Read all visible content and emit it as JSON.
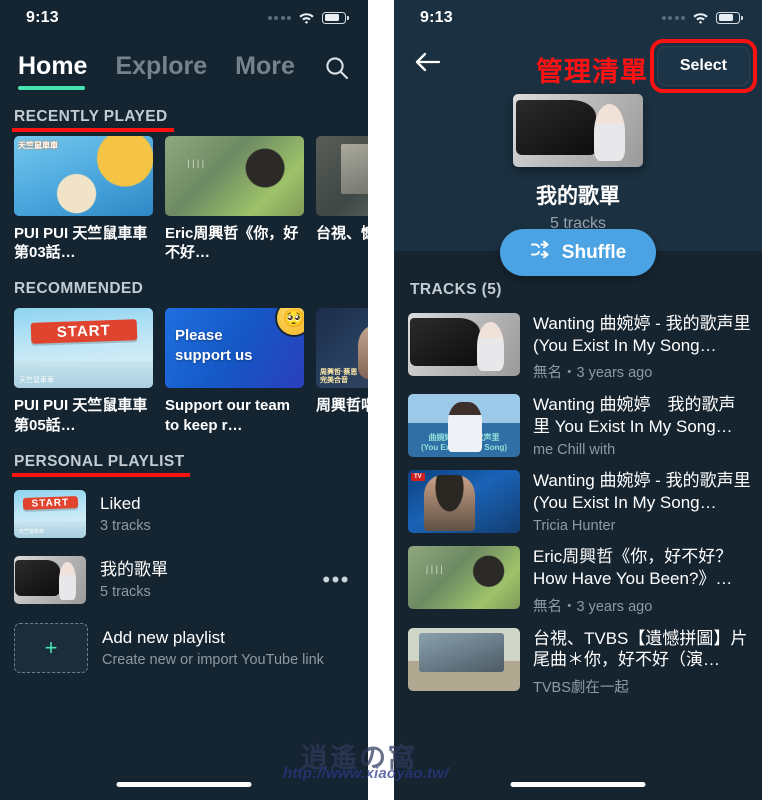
{
  "status_bar": {
    "time": "9:13",
    "wifi_icon": "wifi-icon",
    "battery_icon": "battery-icon",
    "signal_icon": "signal-dots-icon"
  },
  "colors": {
    "accent_green": "#49e3b0",
    "accent_blue": "#4ba3e3",
    "annotation_red": "#fc1212",
    "panel_bg": "#142430",
    "header_bg": "#1b3040"
  },
  "left_screen": {
    "tabs": [
      {
        "label": "Home",
        "active": true
      },
      {
        "label": "Explore",
        "active": false
      },
      {
        "label": "More",
        "active": false
      }
    ],
    "search_icon": "search-icon",
    "sections": {
      "recently_played": {
        "title": "RECENTLY PLAYED",
        "items": [
          {
            "title": "PUI PUI 天竺鼠車車 第03話…",
            "art": "art-pui",
            "badge": "天竺鼠車車"
          },
          {
            "title": "Eric周興哲《你，好不好…",
            "art": "art-eric",
            "badge": ""
          },
          {
            "title": "台視、憾拼圖",
            "art": "art-tvbs",
            "badge": ""
          }
        ]
      },
      "recommended": {
        "title": "RECOMMENDED",
        "items": [
          {
            "title": "PUI PUI 天竺鼠車車 第05話…",
            "art": "art-start",
            "badge": "START"
          },
          {
            "title": "Support our team to keep r…",
            "art": "art-support",
            "badge": "Please support us"
          },
          {
            "title": "周興哲唱「你",
            "art": "art-zhou",
            "badge": "周興哲 蔡恩 完美合音"
          }
        ]
      },
      "personal_playlist": {
        "title": "PERSONAL PLAYLIST",
        "items": [
          {
            "name": "Liked",
            "tracks": "3 tracks",
            "art": "art-start",
            "has_more": false
          },
          {
            "name": "我的歌單",
            "tracks": "5 tracks",
            "art": "art-piano",
            "has_more": true,
            "more_icon": "more-horizontal-icon"
          }
        ],
        "add": {
          "title": "Add new playlist",
          "subtitle": "Create new or import YouTube link",
          "icon": "plus-icon"
        }
      }
    }
  },
  "right_screen": {
    "back_icon": "back-arrow-icon",
    "annotation": "管理清單",
    "select_label": "Select",
    "playlist": {
      "name": "我的歌單",
      "tracks": "5 tracks",
      "art": "art-piano"
    },
    "shuffle": {
      "label": "Shuffle",
      "icon": "shuffle-icon"
    },
    "tracks_header": "TRACKS (5)",
    "tracks": [
      {
        "title": "Wanting 曲婉婷 - 我的歌声里 (You Exist In My Song…",
        "sub": "無名・3 years ago",
        "art": "art-piano"
      },
      {
        "title": "Wanting 曲婉婷　我的歌声里 You Exist In My Song…",
        "sub": "me Chill with",
        "art": "art-sea",
        "caption": "曲婉婷 - 我的歌声里\n(You Exist In My Song)"
      },
      {
        "title": "Wanting 曲婉婷 - 我的歌声里 (You Exist In My Song…",
        "sub": "Tricia Hunter",
        "art": "art-stage"
      },
      {
        "title": "Eric周興哲《你，好不好？How Have You Been?》…",
        "sub": "無名・3 years ago",
        "art": "art-eric"
      },
      {
        "title": "台視、TVBS【遺憾拼圖】片尾曲＊你，好不好（演…",
        "sub": "TVBS劇在一起",
        "art": "art-beach"
      }
    ]
  },
  "watermark": {
    "cjk": "逍遙の窩",
    "url": "http://www.xiaoyao.tw/"
  }
}
